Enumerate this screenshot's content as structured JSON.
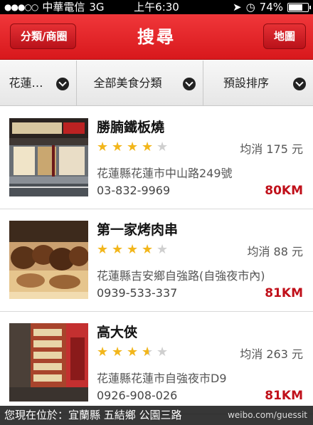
{
  "status": {
    "carrier": "中華電信",
    "network": "3G",
    "time": "上午6:30",
    "battery": "74%",
    "battery_level": 0.74
  },
  "nav": {
    "back_label": "分類/商圈",
    "title": "搜尋",
    "map_label": "地圖"
  },
  "filters": [
    {
      "label": "花蓮…"
    },
    {
      "label": "全部美食分類"
    },
    {
      "label": "預設排序"
    }
  ],
  "restaurants": [
    {
      "name": "勝腩鐵板燒",
      "rating": 4,
      "price": "均消 175 元",
      "address": "花蓮縣花蓮市中山路249號",
      "phone": "03-832-9969",
      "distance": "80KM"
    },
    {
      "name": "第一家烤肉串",
      "rating": 4,
      "price": "均消 88 元",
      "address": "花蓮縣吉安鄉自強路(自強夜市內)",
      "phone": "0939-533-337",
      "distance": "81KM"
    },
    {
      "name": "高大俠",
      "rating": 3.5,
      "price": "均消 263 元",
      "address": "花蓮縣花蓮市自強夜市D9",
      "phone": "0926-908-026",
      "distance": "81KM"
    }
  ],
  "location_bar": {
    "text": "您現在位於：宜蘭縣 五結鄉 公園三路",
    "watermark": "weibo.com/guessit"
  }
}
